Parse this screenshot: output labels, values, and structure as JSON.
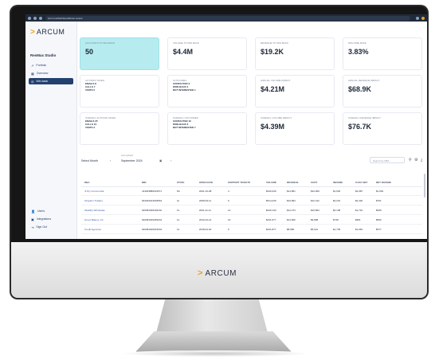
{
  "browser": {
    "url": "arcum.ai/dashboard/book-review"
  },
  "brand": {
    "mark": ">",
    "name": "ARCUM"
  },
  "sidebar": {
    "studio_title": "ResMax Studio",
    "items": [
      {
        "label": "Portfolio",
        "icon": "trend-icon"
      },
      {
        "label": "Overview",
        "icon": "grid-icon"
      },
      {
        "label": "Win-back",
        "icon": "target-icon",
        "active": true
      }
    ],
    "bottom_items": [
      {
        "label": "Users",
        "icon": "users-icon"
      },
      {
        "label": "Integrations",
        "icon": "plug-icon"
      },
      {
        "label": "Sign Out",
        "icon": "signout-icon"
      }
    ]
  },
  "cards": [
    {
      "title": "Accounts to win back",
      "value": "50",
      "highlight": true
    },
    {
      "title": "Volume to win back",
      "value": "$4.4M"
    },
    {
      "title": "Revenue to win back",
      "value": "$19.2K"
    },
    {
      "title": "Win-time rate",
      "value": "3.83%"
    },
    {
      "title": "Actions taken",
      "lines": [
        "EMAILS 8",
        "CALLS 7",
        "VISITS 5"
      ]
    },
    {
      "title": "Outcomes",
      "lines": [
        "CONTACTED 3",
        "WON BACK 2",
        "NOT INTERESTED 1"
      ]
    },
    {
      "title": "Annual volume impact",
      "value": "$4.21M"
    },
    {
      "title": "Annual revenue impact",
      "value": "$68.9K"
    },
    {
      "title": "Overall actions taken",
      "lines": [
        "EMAILS 25",
        "CALLS 15",
        "VISITS 2"
      ]
    },
    {
      "title": "Overall outcomes",
      "lines": [
        "CONTACTED 10",
        "WON BACK 6",
        "NOT INTERESTED 7"
      ]
    },
    {
      "title": "Overall volume impact",
      "value": "$4.39M"
    },
    {
      "title": "Overall revenue impact",
      "value": "$76.7K"
    }
  ],
  "toolbar": {
    "select_label": "Select Month",
    "month_caption": "Last updated",
    "month": "September 2024",
    "search_placeholder": "Search by DBA"
  },
  "table": {
    "headers": [
      "DBA",
      "MID",
      "STATE",
      "OPEN DATE",
      "SUPPORT TICKETS",
      "VOLUME",
      "REVENUE",
      "COST",
      "INCOME",
      "6 DAY NET",
      "NET INCOME"
    ],
    "rows": [
      [
        "Jt Pty Commercial",
        "413023880194571",
        "PA",
        "2021-10-08",
        "4",
        "$340,239",
        "$14,861",
        "$10,009",
        "$1,618",
        "$2,987",
        "$1,664"
      ],
      [
        "Kingdom Traders",
        "934032913618654",
        "IA",
        "2008-09-11",
        "6",
        "$514,239",
        "$16,894",
        "$12,412",
        "$2,201",
        "$2,420",
        "$751"
      ],
      [
        "Wealthy Wholesale",
        "040381020190162",
        "FL",
        "2021-11-11",
        "14",
        "$240,130",
        "$12,274",
        "$10,864",
        "$2,108",
        "$1,791",
        "$935"
      ],
      [
        "Grove Bakery, Inc.",
        "040381020189234",
        "FL",
        "2019-10-21",
        "19",
        "$231,577",
        "$14,606",
        "$9,898",
        "$748",
        "$961",
        "$560"
      ],
      [
        "Credit Agencies",
        "040381020203204",
        "FL",
        "2018-04-02",
        "6",
        "$231,877",
        "$8,580",
        "$5,621",
        "$1,739",
        "$1,981",
        "$577"
      ]
    ]
  }
}
